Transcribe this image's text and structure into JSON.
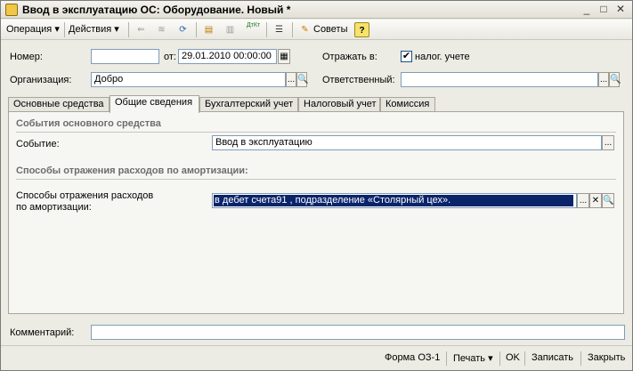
{
  "window": {
    "title": "Ввод в эксплуатацию ОС: Оборудование. Новый *"
  },
  "titlebar_controls": {
    "minimize": "_",
    "maximize": "□",
    "close": "✕"
  },
  "toolbar": {
    "operation": "Операция ▾",
    "actions": "Действия ▾",
    "advice": "Советы",
    "help": "?",
    "dt_kt_icon": "ДтКт"
  },
  "form": {
    "number_label": "Номер:",
    "number_value": "",
    "from_label": "от:",
    "date_value": "29.01.2010 00:00:00",
    "reflect_label": "Отражать в:",
    "tax_label": "налог. учете",
    "tax_checked": "✔",
    "org_label": "Организация:",
    "org_value": "Добро",
    "responsible_label": "Ответственный:",
    "responsible_value": ""
  },
  "tabs": [
    "Основные средства",
    "Общие сведения",
    "Бухгалтерский учет",
    "Налоговый учет",
    "Комиссия"
  ],
  "panel": {
    "events_section": "События основного средства",
    "event_label": "Событие:",
    "event_value": "Ввод в эксплуатацию",
    "expenses_section": "Способы отражения расходов по амортизации:",
    "expenses_label_1": "Способы отражения расходов",
    "expenses_label_2": "по амортизации:",
    "expenses_value": "в дебет счета91 , подразделение «Столярный цех»."
  },
  "comment": {
    "label": "Комментарий:",
    "value": ""
  },
  "statusbar": {
    "form_os1": "Форма ОЗ-1",
    "print": "Печать ▾",
    "ok": "OK",
    "save": "Записать",
    "close": "Закрыть"
  },
  "buttons": {
    "ellipsis": "...",
    "search": "🔍",
    "clear": "✕",
    "calendar": "▦"
  },
  "colors": {
    "selection": "#0a246a",
    "accent": "#e9a400"
  }
}
